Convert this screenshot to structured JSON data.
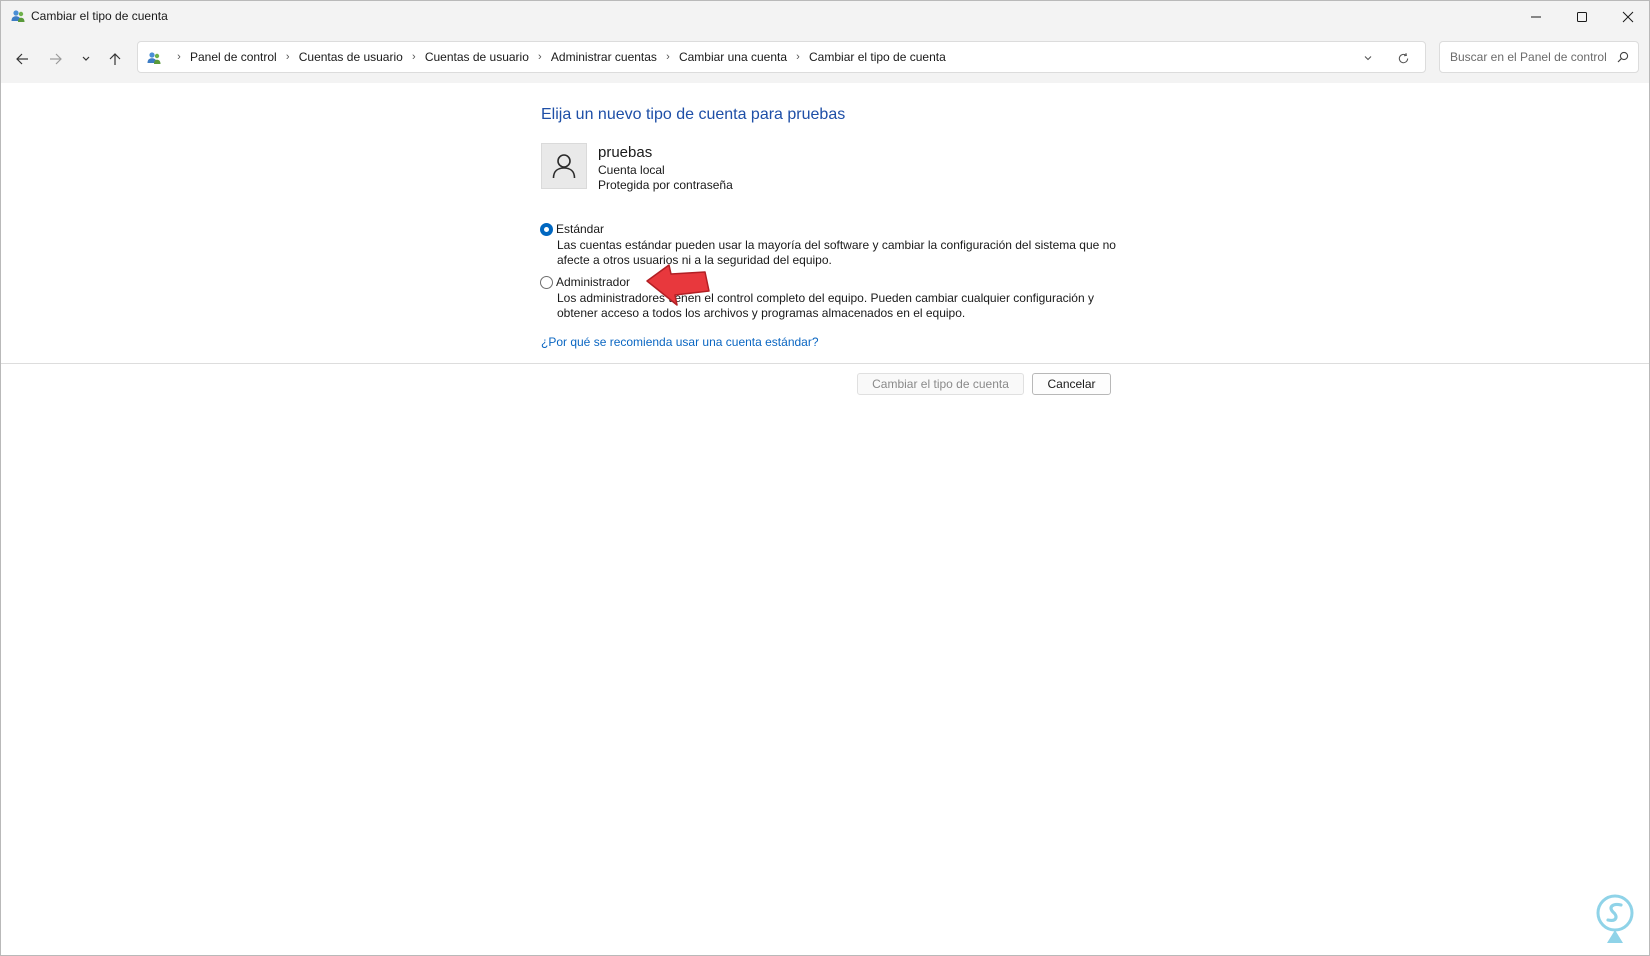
{
  "window": {
    "title": "Cambiar el tipo de cuenta",
    "icons": {
      "app": "users-icon",
      "minimize": "minimize-icon",
      "maximize": "maximize-icon",
      "close": "close-icon"
    }
  },
  "nav": {
    "icons": [
      "back-arrow-icon",
      "forward-arrow-icon",
      "chevron-down-icon",
      "up-arrow-icon"
    ],
    "breadcrumbs": [
      "Panel de control",
      "Cuentas de usuario",
      "Cuentas de usuario",
      "Administrar cuentas",
      "Cambiar una cuenta",
      "Cambiar el tipo de cuenta"
    ],
    "search_placeholder": "Buscar en el Panel de control"
  },
  "main": {
    "heading": "Elija un nuevo tipo de cuenta para pruebas",
    "user": {
      "name": "pruebas",
      "type": "Cuenta local",
      "protection": "Protegida por contraseña"
    },
    "options": [
      {
        "label": "Estándar",
        "description": "Las cuentas estándar pueden usar la mayoría del software y cambiar la configuración del sistema que no afecte a otros usuarios ni a la seguridad del equipo.",
        "selected": true
      },
      {
        "label": "Administrador",
        "description": "Los administradores tienen el control completo del equipo. Pueden cambiar cualquier configuración y obtener acceso a todos los archivos y programas almacenados en el equipo.",
        "selected": false
      }
    ],
    "help_link": "¿Por qué se recomienda usar una cuenta estándar?"
  },
  "buttons": {
    "change": "Cambiar el tipo de cuenta",
    "cancel": "Cancelar"
  },
  "colors": {
    "heading": "#1e4fa7",
    "link": "#0a66c2",
    "radio_selected": "#0067c0",
    "annotation_arrow": "#e8383d",
    "watermark": "#8fd3e8"
  }
}
